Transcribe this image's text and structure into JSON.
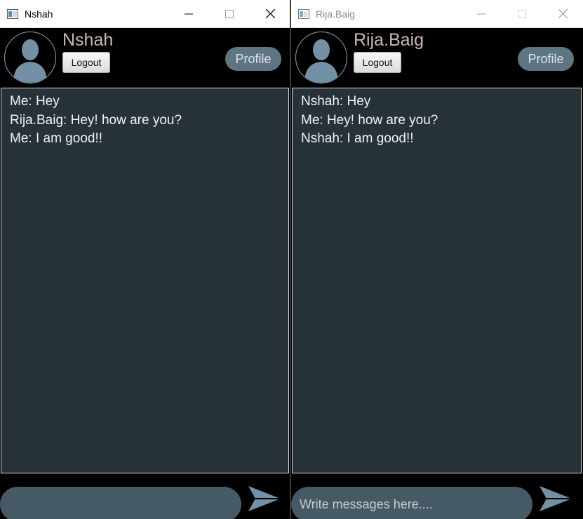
{
  "windows": [
    {
      "title": "Nshah",
      "title_active": true,
      "username": "Nshah",
      "logout_label": "Logout",
      "profile_label": "Profile",
      "messages": [
        "Me: Hey",
        "Rija.Baig: Hey! how are you?",
        "Me: I am good!!"
      ],
      "input_value": "",
      "input_placeholder": ""
    },
    {
      "title": "Rija.Baig",
      "title_active": false,
      "username": "Rija.Baig",
      "logout_label": "Logout",
      "profile_label": "Profile",
      "messages": [
        "Nshah: Hey",
        "Me: Hey! how are you?",
        "Nshah: I am good!!"
      ],
      "input_value": "",
      "input_placeholder": "Write messages here...."
    }
  ],
  "icons": {
    "app": "app-window-icon",
    "minimize": "minimize-icon",
    "maximize": "maximize-icon",
    "close": "close-icon",
    "avatar": "user-silhouette-icon",
    "send": "paper-plane-send-icon"
  },
  "colors": {
    "chat_bg": "#263238",
    "input_bg": "#455a64",
    "profile_btn": "#5e7582",
    "username": "#cbb9b0",
    "accent_icon": "#7391a4"
  }
}
